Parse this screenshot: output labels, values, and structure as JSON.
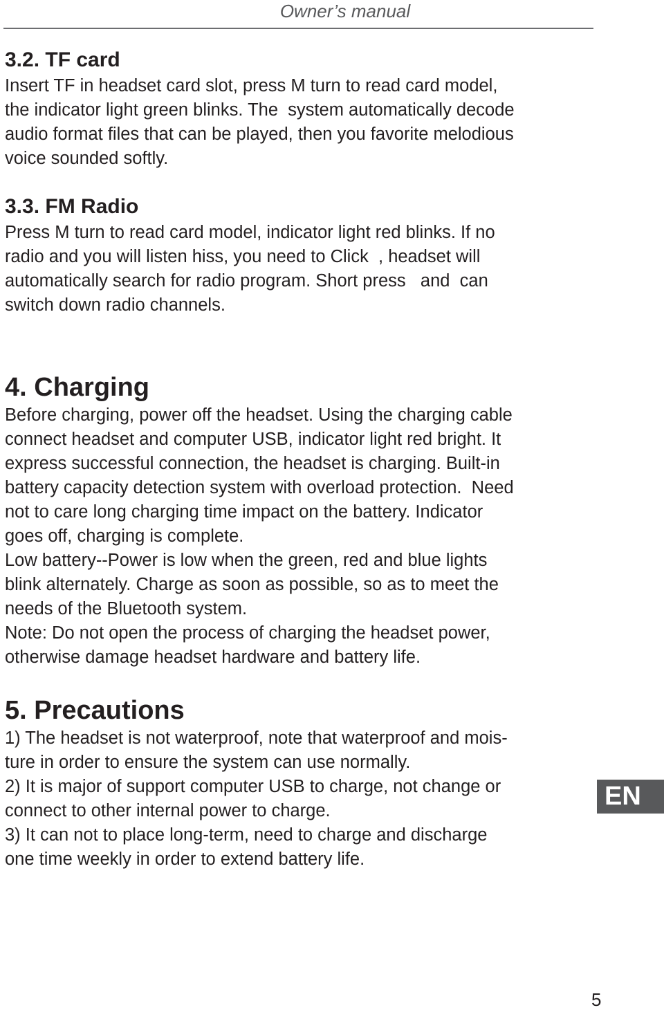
{
  "header": {
    "title": "Owner’s manual"
  },
  "sections": {
    "tf_card": {
      "heading": "3.2. TF card",
      "lines": [
        "Insert TF in headset card slot, press M turn to read card model,",
        "the indicator light green blinks. The  system automatically decode",
        "audio format files that can be played, then you favorite melodious",
        "voice sounded softly."
      ]
    },
    "fm_radio": {
      "heading": "3.3. FM Radio",
      "lines": [
        "Press M turn to read card model, indicator light red blinks. If no",
        "radio and you will listen hiss, you need to Click  , headset will",
        "automatically search for radio program. Short press   and  can",
        "switch down radio channels."
      ]
    },
    "charging": {
      "heading": "4. Charging",
      "lines": [
        "Before charging, power off the headset. Using the charging cable",
        "connect headset and computer USB, indicator light red bright. It",
        "express successful connection, the headset is charging. Built-in",
        "battery capacity detection system with overload protection.  Need",
        "not to care long charging time impact on the battery. Indicator",
        "goes off, charging is complete.",
        "Low battery--Power is low when the green, red and blue lights",
        "blink alternately. Charge as soon as possible, so as to meet the",
        "needs of the Bluetooth system.",
        "Note: Do not open the process of charging the headset power,",
        "otherwise damage headset hardware and battery life."
      ]
    },
    "precautions": {
      "heading": "5. Precautions",
      "lines": [
        "1) The headset is not waterproof, note that waterproof and mois-",
        "ture in order to ensure the system can use normally.",
        "2) It is major of support computer USB to charge, not change or",
        "connect to other internal power to charge.",
        "3) It can not to place long-term, need to charge and discharge",
        "one time weekly in order to extend battery life."
      ]
    }
  },
  "language_tab": {
    "label": "EN",
    "background_color": "#58595b"
  },
  "footer": {
    "page_number": "5"
  }
}
